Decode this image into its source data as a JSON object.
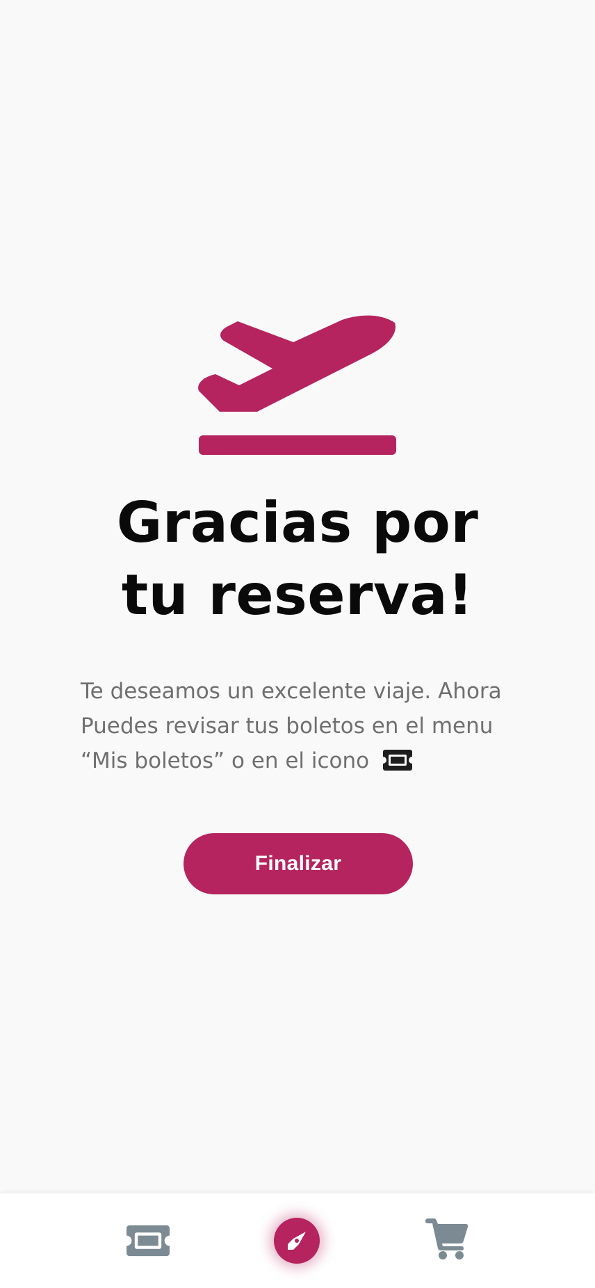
{
  "confirmation": {
    "title_line1": "Gracias por",
    "title_line2": "tu reserva!",
    "message_line1": "Te deseamos un excelente viaje. Ahora",
    "message_line2": "Puedes revisar tus boletos en el menu",
    "message_line3": "“Mis boletos” o en el icono",
    "hero_icon": "airplane-takeoff-icon",
    "inline_icon": "ticket-icon"
  },
  "actions": {
    "finish_label": "Finalizar"
  },
  "bottom_nav": {
    "items": [
      {
        "icon": "ticket-icon",
        "active": false
      },
      {
        "icon": "compass-icon",
        "active": true
      },
      {
        "icon": "cart-icon",
        "active": false
      }
    ]
  },
  "colors": {
    "accent": "#b5245e",
    "background": "#f9f9fa",
    "title": "#0a0a0a",
    "body_text": "#6f6f6f",
    "inactive_icon": "#7b8a93"
  }
}
